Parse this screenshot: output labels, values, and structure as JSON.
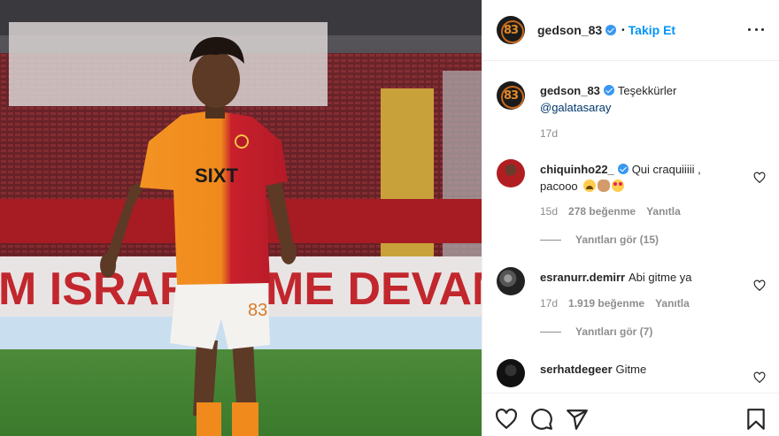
{
  "post": {
    "username": "gedson_83",
    "separator": "•",
    "follow_label": "Takip Et",
    "caption_user": "gedson_83",
    "caption_text": "Teşekkürler",
    "caption_mention": "@galatasaray",
    "caption_age": "17d"
  },
  "photo": {
    "banner_left": "M ISRARLA",
    "banner_right": "ME DEVAM E",
    "sponsor": "SIXT",
    "shirt_number": "83"
  },
  "comments": [
    {
      "username": "chiquinho22_",
      "text": "Qui craquiiiii ,",
      "text2": "pacooo",
      "age": "15d",
      "likes": "278 beğenme",
      "reply_label": "Yanıtla",
      "view_replies": "Yanıtları gör (15)"
    },
    {
      "username": "esranurr.demirr",
      "text": "Abi gitme ya",
      "age": "17d",
      "likes": "1.919 beğenme",
      "reply_label": "Yanıtla",
      "view_replies": "Yanıtları gör (7)"
    },
    {
      "username": "serhatdegeer",
      "text": "Gitme"
    }
  ],
  "colors": {
    "link_blue": "#0095f6",
    "verified_blue": "#3897f0",
    "mention": "#00376b",
    "muted": "#8e8e8e",
    "jersey_orange": "#f08a1c",
    "jersey_red": "#c8202c"
  },
  "icons": [
    "verified-badge-icon",
    "more-options-icon",
    "heart-icon",
    "comment-icon",
    "share-icon",
    "bookmark-icon"
  ]
}
